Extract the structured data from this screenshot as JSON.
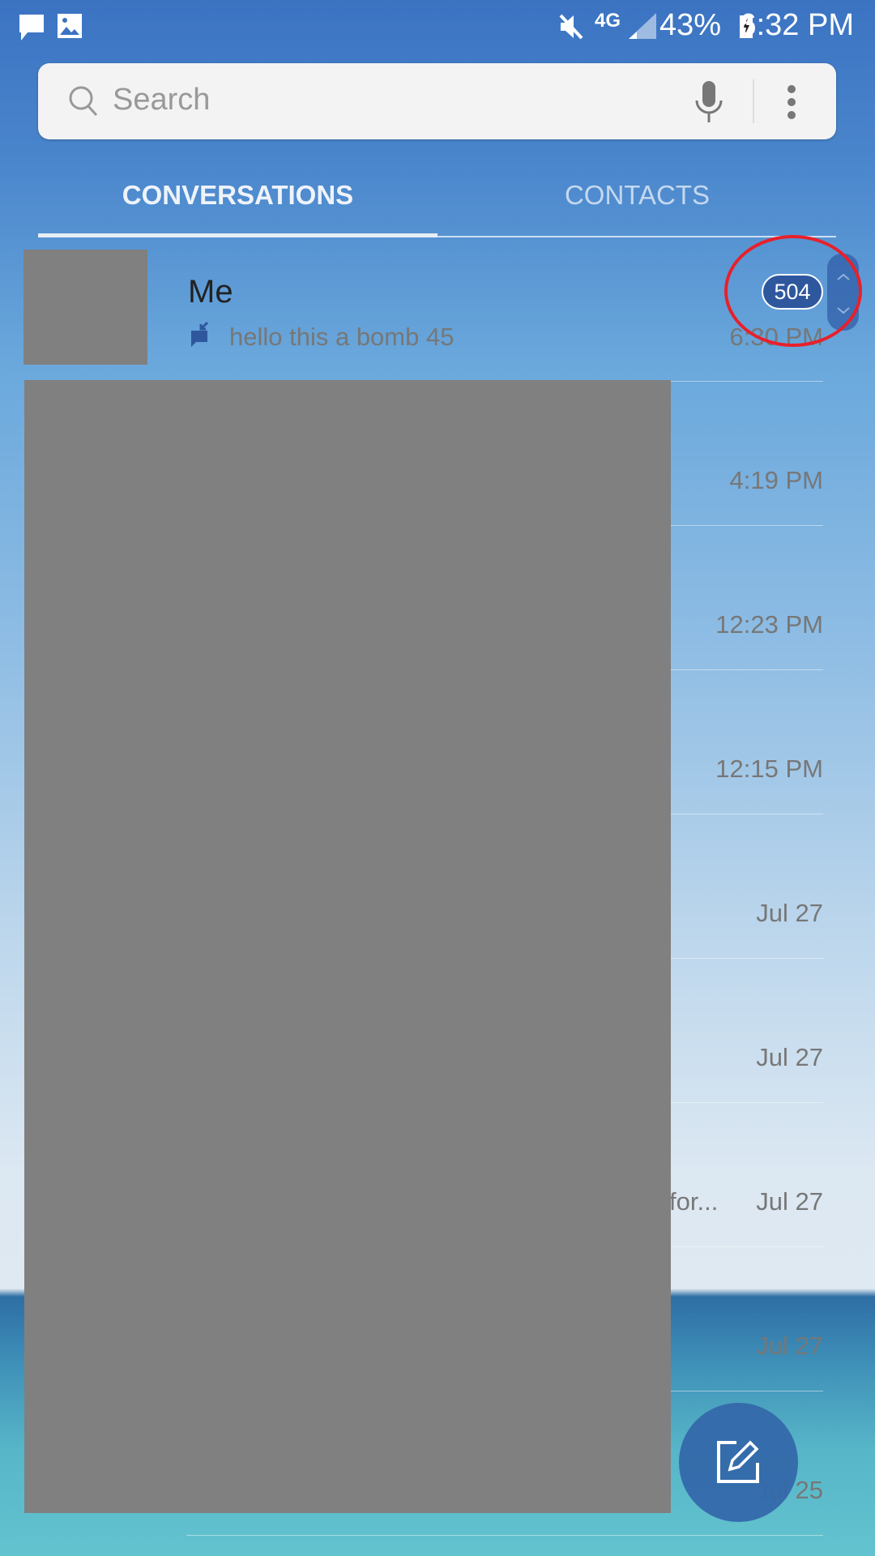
{
  "status_bar": {
    "time": "6:32 PM",
    "battery": "43%",
    "network": "4G",
    "icons": [
      "message-icon",
      "image-icon",
      "mute-icon",
      "signal-icon",
      "battery-charging-icon"
    ]
  },
  "search": {
    "placeholder": "Search",
    "icons": [
      "search-icon",
      "mic-icon",
      "more-vert-icon"
    ]
  },
  "tabs": [
    {
      "label": "CONVERSATIONS",
      "active": true
    },
    {
      "label": "CONTACTS",
      "active": false
    }
  ],
  "conversations": [
    {
      "name": "Me",
      "preview": "hello this a bomb 45",
      "time": "6:30 PM",
      "unread": "504"
    },
    {
      "time": "4:19 PM"
    },
    {
      "time": "12:23 PM"
    },
    {
      "time": "12:15 PM"
    },
    {
      "time": "Jul 27"
    },
    {
      "time": "Jul 27"
    },
    {
      "time": "Jul 27",
      "preview_fragment": "for..."
    },
    {
      "time": "Jul 27"
    },
    {
      "time": "Jul 25"
    }
  ],
  "fab": {
    "icon": "compose-icon"
  },
  "colors": {
    "accent": "#2e579e",
    "fab": "#3a6fae",
    "annotation": "#e8202a"
  }
}
